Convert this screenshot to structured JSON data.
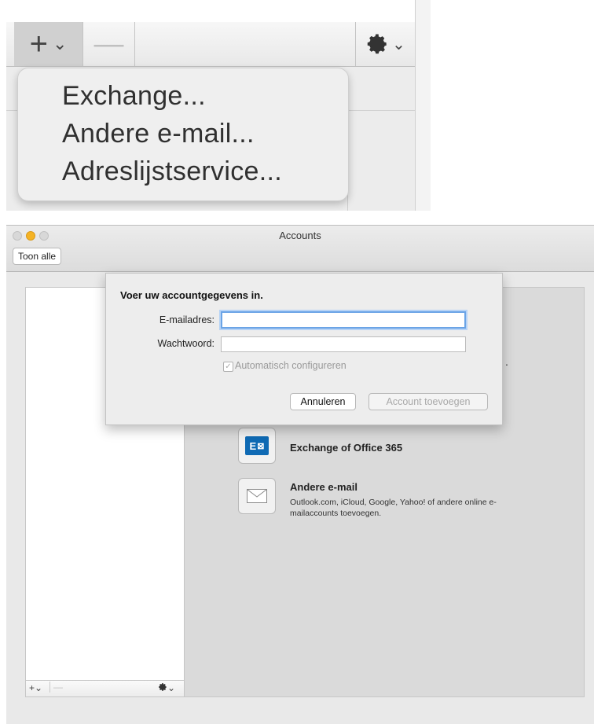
{
  "zoomed_menu": {
    "add_glyph": "+",
    "remove_glyph": "—",
    "gear_glyph": "✲",
    "chevron": "⌄",
    "items": [
      "Exchange...",
      "Andere e-mail...",
      "Adreslijstservice..."
    ]
  },
  "window": {
    "title": "Accounts",
    "show_all_button": "Toon alle",
    "sidebar_toolbar": {
      "add": "+⌄",
      "remove": "—",
      "gear": "✲⌄"
    }
  },
  "sheet": {
    "heading": "Voer uw accountgegevens in.",
    "email_label": "E-mailadres:",
    "email_value": "",
    "password_label": "Wachtwoord:",
    "password_value": "",
    "auto_configure_label": "Automatisch configureren",
    "auto_configure_checked": true,
    "cancel_button": "Annuleren",
    "add_account_button": "Account toevoegen"
  },
  "account_types": [
    {
      "title": "Exchange of Office 365",
      "icon": "exchange-icon",
      "icon_text": "E"
    },
    {
      "title": "Andere e-mail",
      "icon": "envelope-icon",
      "description": "Outlook.com, iCloud, Google, Yahoo! of andere online e-mailaccounts toevoegen."
    }
  ],
  "colors": {
    "exchange_blue": "#0f6ab4",
    "focus_ring": "#6ba4e6",
    "traffic_yellow": "#f5b324"
  }
}
